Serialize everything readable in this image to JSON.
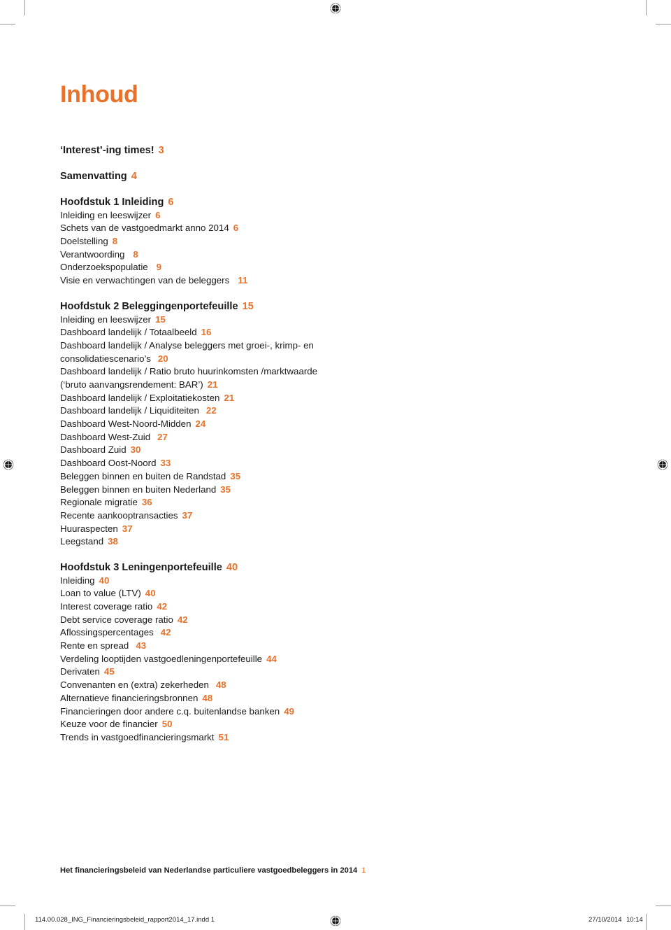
{
  "title": "Inhoud",
  "accent_color": "#e8722a",
  "toc": {
    "intro": [
      {
        "label": "‘Interest’-ing times!",
        "page": "3"
      },
      {
        "label": "Samenvatting",
        "page": "4"
      }
    ],
    "chapters": [
      {
        "heading": "Hoofdstuk 1 Inleiding",
        "page": "6",
        "items": [
          {
            "label": "Inleiding en leeswijzer",
            "page": "6"
          },
          {
            "label": "Schets van de vastgoedmarkt anno 2014",
            "page": "6"
          },
          {
            "label": "Doelstelling",
            "page": "8"
          },
          {
            "label": "Verantwoording",
            "page": "8"
          },
          {
            "label": "Onderzoekspopulatie",
            "page": "9"
          },
          {
            "label": "Visie en verwachtingen van de beleggers",
            "page": "11"
          }
        ]
      },
      {
        "heading": "Hoofdstuk 2 Beleggingenportefeuille",
        "page": "15",
        "items": [
          {
            "label": "Inleiding en leeswijzer",
            "page": "15"
          },
          {
            "label": "Dashboard landelijk / Totaalbeeld",
            "page": "16"
          },
          {
            "label": "Dashboard landelijk / Analyse beleggers met groei-, krimp- en consolidatiescenario’s",
            "page": "20"
          },
          {
            "label": "Dashboard landelijk / Ratio bruto huurinkomsten /marktwaarde (‘bruto aanvangsrendement: BAR’)",
            "page": "21"
          },
          {
            "label": "Dashboard landelijk / Exploitatiekosten",
            "page": "21"
          },
          {
            "label": "Dashboard landelijk / Liquiditeiten",
            "page": "22"
          },
          {
            "label": "Dashboard West-Noord-Midden",
            "page": "24"
          },
          {
            "label": "Dashboard West-Zuid",
            "page": "27"
          },
          {
            "label": "Dashboard Zuid",
            "page": "30"
          },
          {
            "label": "Dashboard Oost-Noord",
            "page": "33"
          },
          {
            "label": "Beleggen binnen en buiten de Randstad",
            "page": "35"
          },
          {
            "label": "Beleggen binnen en buiten Nederland",
            "page": "35"
          },
          {
            "label": "Regionale migratie",
            "page": "36"
          },
          {
            "label": "Recente aankooptransacties",
            "page": "37"
          },
          {
            "label": "Huuraspecten",
            "page": "37"
          },
          {
            "label": "Leegstand",
            "page": "38"
          }
        ]
      },
      {
        "heading": "Hoofdstuk 3 Leningenportefeuille",
        "page": "40",
        "items": [
          {
            "label": "Inleiding",
            "page": "40"
          },
          {
            "label": "Loan to value (LTV)",
            "page": "40"
          },
          {
            "label": "Interest coverage ratio",
            "page": "42"
          },
          {
            "label": "Debt service coverage ratio",
            "page": "42"
          },
          {
            "label": "Aflossingspercentages",
            "page": "42"
          },
          {
            "label": "Rente en spread",
            "page": "43"
          },
          {
            "label": "Verdeling looptijden vastgoedleningenportefeuille",
            "page": "44"
          },
          {
            "label": "Derivaten",
            "page": "45"
          },
          {
            "label": "Convenanten en (extra) zekerheden",
            "page": "48"
          },
          {
            "label": "Alternatieve financieringsbronnen",
            "page": "48"
          },
          {
            "label": "Financieringen door andere c.q. buitenlandse banken",
            "page": "49"
          },
          {
            "label": "Keuze voor de financier",
            "page": "50"
          },
          {
            "label": "Trends in vastgoedfinancieringsmarkt",
            "page": "51"
          }
        ]
      }
    ]
  },
  "footer": {
    "running_title": "Het financieringsbeleid van Nederlandse particuliere vastgoedbeleggers in 2014",
    "page_number": "1"
  },
  "slug": {
    "file": "114.00.028_ING_Financieringsbeleid_rapport2014_17.indd   1",
    "date": "27/10/2014",
    "time": "10:14"
  },
  "icons": {
    "registration_mark": "registration-mark-icon"
  }
}
